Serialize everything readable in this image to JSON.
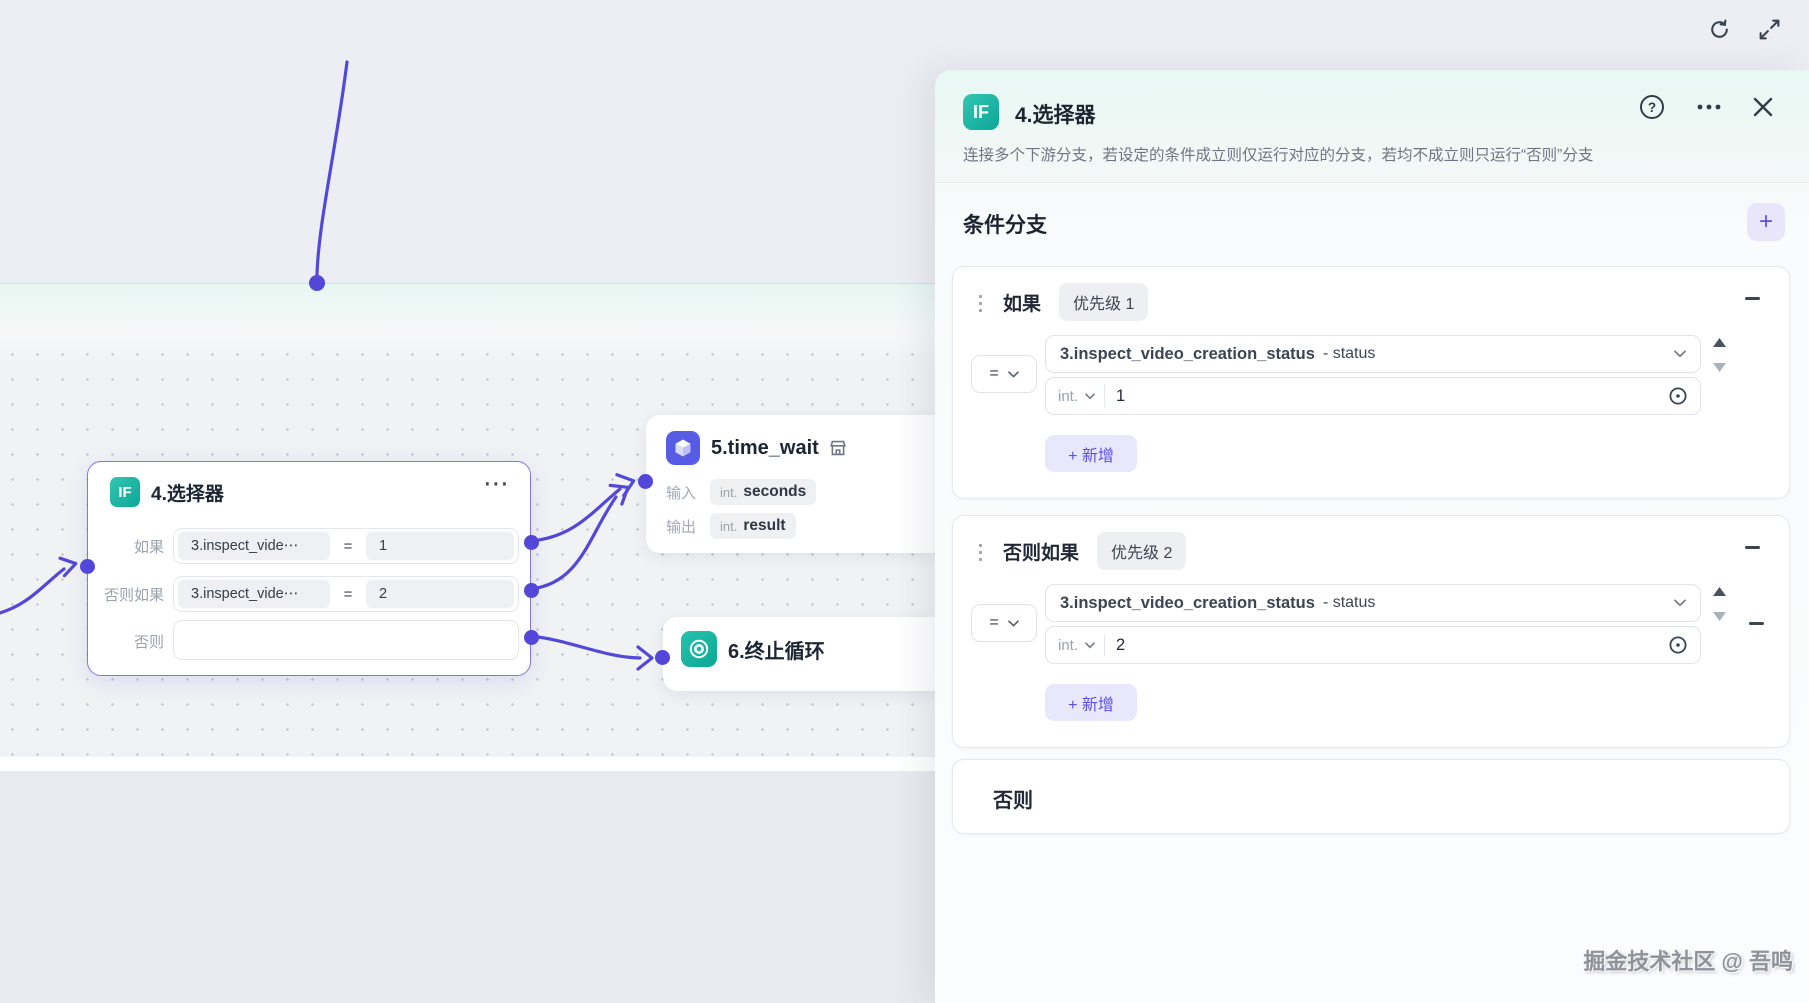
{
  "colors": {
    "accent": "#5A4FE8",
    "edge": "#5348D8",
    "teal": "#0DA697",
    "indigo": "#575CE5"
  },
  "toolbar": {
    "refresh_icon": "refresh",
    "expand_icon": "expand"
  },
  "canvas": {
    "selector_node": {
      "icon": "IF",
      "title": "4.选择器",
      "more_glyph": "⋯",
      "rows": [
        {
          "label": "如果",
          "ref": "3.inspect_vide⋯",
          "op": "=",
          "value": "1"
        },
        {
          "label": "否则如果",
          "ref": "3.inspect_vide⋯",
          "op": "=",
          "value": "2"
        },
        {
          "label": "否则"
        }
      ]
    },
    "time_wait_node": {
      "title": "5.time_wait",
      "rows": [
        {
          "label": "输入",
          "type": "int.",
          "name": "seconds"
        },
        {
          "label": "输出",
          "type": "int.",
          "name": "result"
        }
      ]
    },
    "break_node": {
      "title": "6.终止循环"
    }
  },
  "panel": {
    "header": {
      "icon": "IF",
      "title": "4.选择器",
      "help_glyph": "?",
      "more_glyph": "•••",
      "description": "连接多个下游分支，若设定的条件成立则仅运行对应的分支，若均不成立则只运行“否则”分支"
    },
    "section": {
      "title": "条件分支",
      "add_glyph": "+"
    },
    "branches": [
      {
        "label": "如果",
        "priority": "优先级 1",
        "operator": "=",
        "reference": "3.inspect_video_creation_status",
        "ref_field": "- status",
        "value_type": "int.",
        "value": "1",
        "add_label": "+ 新增"
      },
      {
        "label": "否则如果",
        "priority": "优先级 2",
        "operator": "=",
        "reference": "3.inspect_video_creation_status",
        "ref_field": "- status",
        "value_type": "int.",
        "value": "2",
        "add_label": "+ 新增"
      }
    ],
    "else_card": {
      "label": "否则"
    },
    "watermark": "掘金技术社区 @ 吾鸣"
  }
}
